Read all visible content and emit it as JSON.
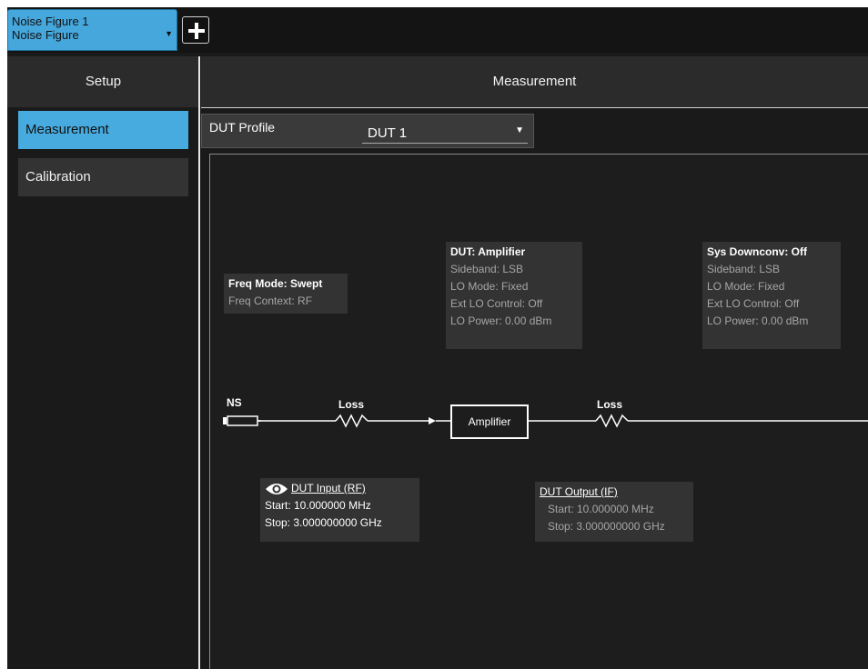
{
  "tab": {
    "line1": "Noise Figure 1",
    "line2": "Noise Figure",
    "dropdown_icon": "triangle-down",
    "add_icon": "plus"
  },
  "setup": {
    "header": "Setup",
    "items": [
      {
        "label": "Measurement",
        "selected": true
      },
      {
        "label": "Calibration",
        "selected": false
      }
    ]
  },
  "measurement": {
    "header": "Measurement",
    "dut_profile": {
      "label": "DUT Profile",
      "value": "DUT 1"
    }
  },
  "diagram": {
    "freq": {
      "mode": "Freq Mode: Swept",
      "context": "Freq Context: RF"
    },
    "dut": {
      "title": "DUT: Amplifier",
      "sideband": "Sideband: LSB",
      "lo_mode": "LO Mode: Fixed",
      "ext_lo": "Ext LO Control: Off",
      "lo_power": "LO Power: 0.00 dBm"
    },
    "sys": {
      "title": "Sys Downconv: Off",
      "sideband": "Sideband: LSB",
      "lo_mode": "LO Mode: Fixed",
      "ext_lo": "Ext LO Control: Off",
      "lo_power": "LO Power: 0.00 dBm"
    },
    "ns_label": "NS",
    "loss1_label": "Loss",
    "amp_label": "Amplifier",
    "loss2_label": "Loss",
    "input": {
      "title": "DUT Input (RF)",
      "start": "Start: 10.000000 MHz",
      "stop": "Stop: 3.000000000 GHz",
      "icon": "eye"
    },
    "output": {
      "title": "DUT Output (IF)",
      "start": "Start: 10.000000 MHz",
      "stop": "Stop: 3.000000000 GHz"
    }
  },
  "colors": {
    "accent": "#46a7dc",
    "background": "#1a1a1a",
    "panel": "#333333"
  }
}
